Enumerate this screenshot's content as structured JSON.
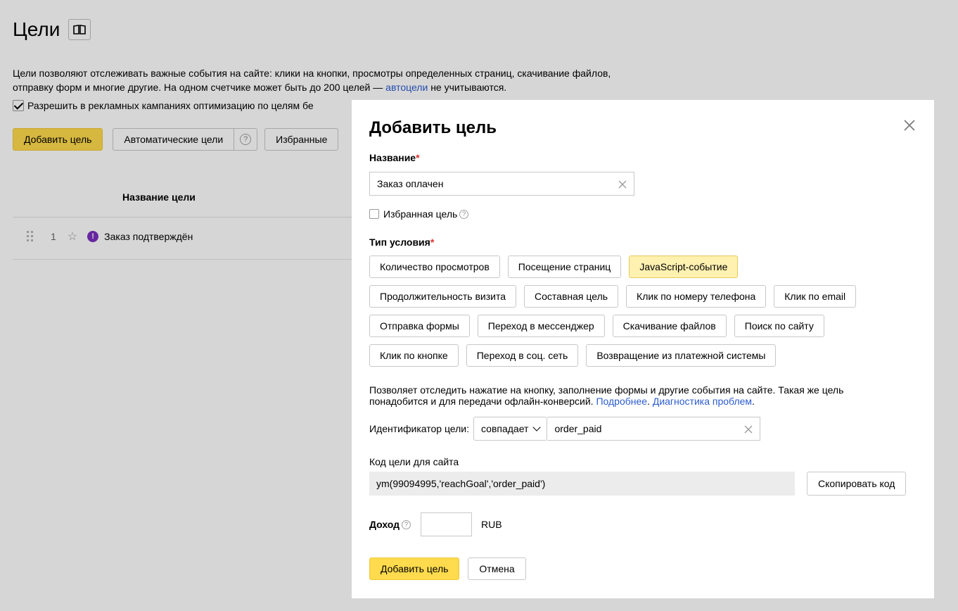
{
  "page": {
    "title": "Цели",
    "description_1": "Цели позволяют отслеживать важные события на сайте: клики на кнопки, просмотры определенных страниц, скачивание файлов,",
    "description_2": "отправку форм и многие другие. На одном счетчике может быть до 200 целей — ",
    "autogoals_link": "автоцели",
    "description_3": " не учитываются.",
    "optimization_label": "Разрешить в рекламных кампаниях оптимизацию по целям бе",
    "add_goal_button": "Добавить цель",
    "auto_goals_button": "Автоматические цели",
    "favorites_button": "Избранные",
    "column_header": "Название цели",
    "goals": [
      {
        "number": "1",
        "name": "Заказ подтверждён"
      }
    ]
  },
  "modal": {
    "title": "Добавить цель",
    "name_label": "Название",
    "required_mark": "*",
    "name_value": "Заказ оплачен",
    "favorite_label": "Избранная цель",
    "condition_label": "Тип условия",
    "condition_types": [
      [
        "Количество просмотров",
        "Посещение страниц",
        "JavaScript-событие"
      ],
      [
        "Продолжительность визита",
        "Составная цель",
        "Клик по номеру телефона",
        "Клик по email"
      ],
      [
        "Отправка формы",
        "Переход в мессенджер",
        "Скачивание файлов",
        "Поиск по сайту"
      ],
      [
        "Клик по кнопке",
        "Переход в соц. сеть",
        "Возвращение из платежной системы"
      ]
    ],
    "selected_condition": "JavaScript-событие",
    "info_text_1": "Позволяет отследить нажатие на кнопку, заполнение формы и другие события на сайте. Такая же цель",
    "info_text_2": "понадобится и для передачи офлайн-конверсий. ",
    "more_link": "Подробнее",
    "diag_link": "Диагностика проблем",
    "id_label": "Идентификатор цели:",
    "match_value": "совпадает",
    "id_value": "order_paid",
    "code_label": "Код цели для сайта",
    "code_value": "ym(99094995,'reachGoal','order_paid')",
    "copy_button": "Скопировать код",
    "income_label": "Доход",
    "currency": "RUB",
    "submit_button": "Добавить цель",
    "cancel_button": "Отмена"
  },
  "icons": {
    "help": "?",
    "warn": "!",
    "star": "☆"
  },
  "colors": {
    "accent_yellow": "#ffdb4d",
    "selected_yellow": "#fff1b0",
    "link_blue": "#2c5ccf",
    "required_red": "#e03030",
    "warn_purple": "#7b2fbf"
  }
}
